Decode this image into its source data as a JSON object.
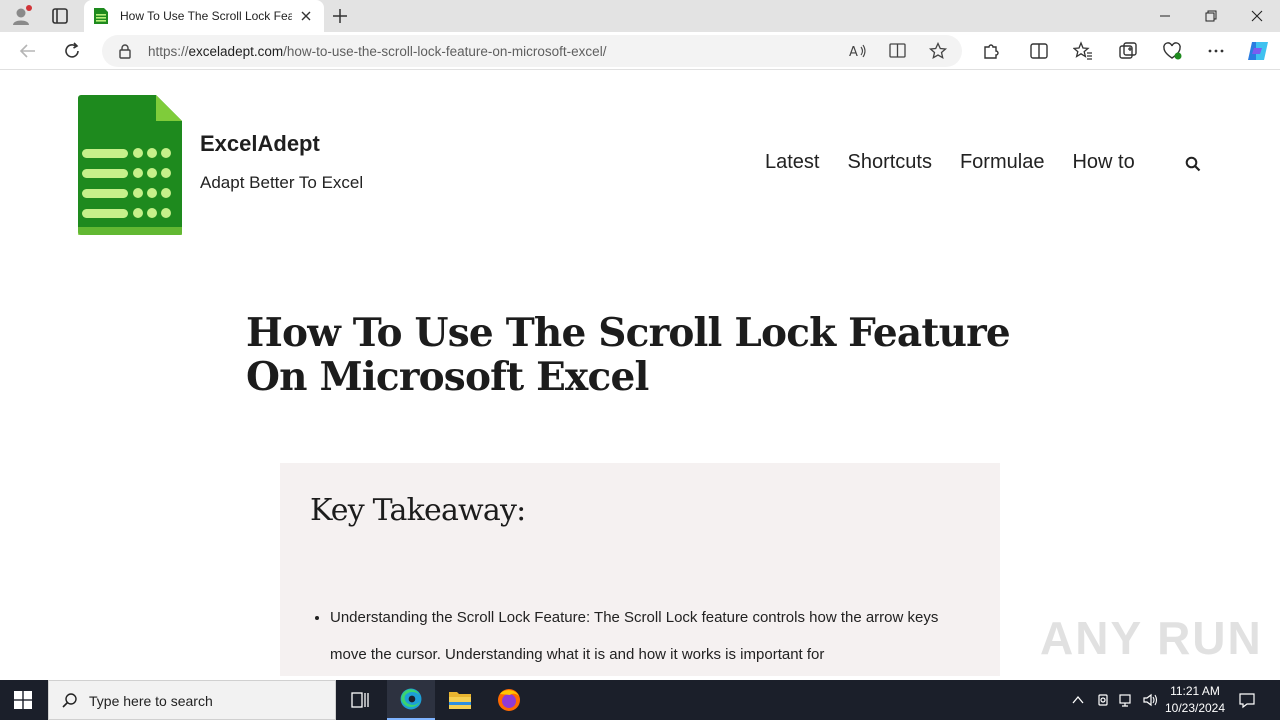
{
  "browser": {
    "tab_title": "How To Use The Scroll Lock Feature On Microsoft Excel",
    "url_scheme": "https://",
    "url_host": "exceladept.com",
    "url_path": "/how-to-use-the-scroll-lock-feature-on-microsoft-excel/",
    "icons": [
      "profile-icon",
      "tab-actions-icon",
      "excel-favicon",
      "close-icon",
      "plus-icon",
      "minimize-icon",
      "restore-icon",
      "close-window-icon",
      "back-icon",
      "refresh-icon",
      "lock-icon",
      "read-aloud-icon",
      "immersive-reader-icon",
      "star-icon",
      "extensions-icon",
      "split-screen-icon",
      "favorites-icon",
      "collections-icon",
      "performance-icon",
      "more-icon",
      "copilot-icon"
    ]
  },
  "site": {
    "brand": "ExcelAdept",
    "tagline": "Adapt Better To Excel",
    "brand_color": "#1e8a1e",
    "nav": [
      "Latest",
      "Shortcuts",
      "Formulae",
      "How to"
    ]
  },
  "article": {
    "title": "How To Use The Scroll Lock Feature On Microsoft Excel",
    "takeaway_heading": "Key Takeaway:",
    "bullets": [
      "Understanding the Scroll Lock Feature: The Scroll Lock feature controls how the arrow keys move the cursor. Understanding what it is and how it works is important for"
    ]
  },
  "watermark": "ANY RUN",
  "taskbar": {
    "search_placeholder": "Type here to search",
    "time": "11:21 AM",
    "date": "10/23/2024",
    "apps": [
      "task-view-icon",
      "edge-icon",
      "file-explorer-icon",
      "firefox-icon"
    ]
  }
}
